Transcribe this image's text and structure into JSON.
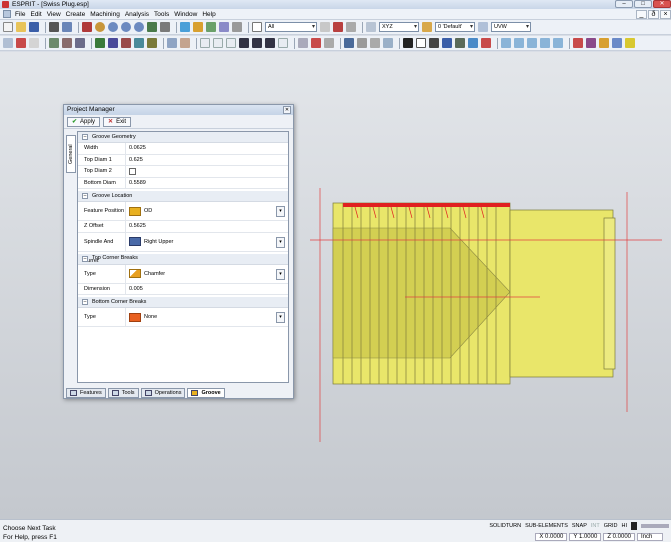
{
  "window": {
    "title": "ESPRIT - [Swiss Plug.esp]",
    "buttons": [
      "–",
      "□",
      "✕"
    ]
  },
  "menu": {
    "items": [
      "File",
      "Edit",
      "View",
      "Create",
      "Machining",
      "Analysis",
      "Tools",
      "Window",
      "Help"
    ],
    "mdi_buttons": [
      "_",
      "ð",
      "×"
    ]
  },
  "toolbar": {
    "filter_combo": "All",
    "view_combo": "XYZ",
    "layer_combo": "0 'Default'",
    "plane_combo": "UVW"
  },
  "project_manager": {
    "title": "Project Manager",
    "apply_label": "Apply",
    "exit_label": "Exit",
    "side_tab": "General",
    "sections": {
      "groove_geometry": "Groove Geometry",
      "groove_location": "Groove Location",
      "top_corner": "Top Corner Breaks",
      "bottom_corner": "Bottom Corner Breaks"
    },
    "props": {
      "width": {
        "label": "Width",
        "value": "0.0625"
      },
      "top_diam1": {
        "label": "Top Diam 1",
        "value": "0.625"
      },
      "top_diam2": {
        "label": "Top Diam 2",
        "checked": false
      },
      "bottom_diam": {
        "label": "Bottom Diam",
        "value": "0.5589"
      },
      "feature_position": {
        "label": "Feature Position",
        "value": "OD"
      },
      "z_offset": {
        "label": "Z Offset",
        "value": "0.5625"
      },
      "spindle_turret": {
        "label": "Spindle And Turret",
        "value": "Right Upper"
      },
      "top_type": {
        "label": "Type",
        "value": "Chamfer"
      },
      "dimension": {
        "label": "Dimension",
        "value": "0.005"
      },
      "bottom_type": {
        "label": "Type",
        "value": "None"
      }
    },
    "tabs": [
      "Features",
      "Tools",
      "Operations",
      "Groove"
    ]
  },
  "status": {
    "line1": "Choose Next Task",
    "line2": "For Help, press F1",
    "modes": [
      "SOLIDTURN",
      "SUB-ELEMENTS",
      "SNAP",
      "INT",
      "GRID",
      "HI"
    ],
    "x": "X 0.0000",
    "y": "Y 1.0000",
    "z": "Z 0.0000",
    "units": "Inch"
  }
}
